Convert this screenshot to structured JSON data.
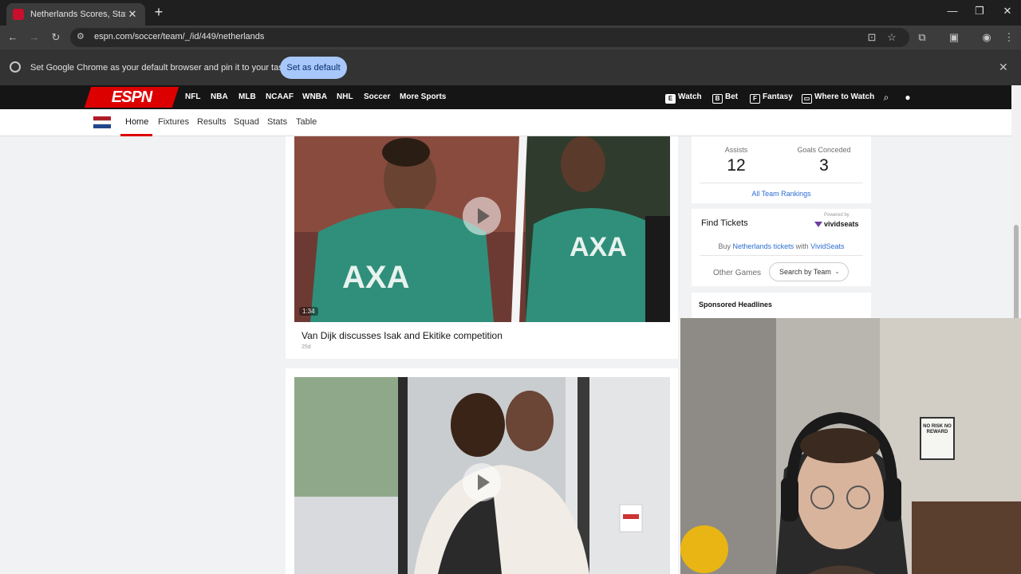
{
  "browser": {
    "tab_title": "Netherlands Scores, Stats and Highlights - ESPN",
    "tab_close": "✕",
    "new_tab": "+",
    "url": "espn.com/soccer/team/_/id/449/netherlands",
    "infobar_text": "Set Google Chrome as your default browser and pin it to your taskbar",
    "set_default_label": "Set as default",
    "infobar_close": "✕",
    "window_controls": {
      "minimize": "—",
      "restore": "❐",
      "close": "✕"
    },
    "toolbar_icons": {
      "back": "←",
      "forward": "→",
      "reload": "↻",
      "site_info": "⚙",
      "install": "⊡",
      "bookmark": "☆",
      "extensions": "⧉",
      "side_panel": "▣",
      "profile": "◉",
      "menu": "⋮"
    }
  },
  "espn_nav": {
    "logo": "ESPN",
    "links": [
      "NFL",
      "NBA",
      "MLB",
      "NCAAF",
      "WNBA",
      "NHL",
      "Soccer",
      "More Sports"
    ],
    "active": "Soccer",
    "right_links": {
      "watch": "Watch",
      "bet": "Bet",
      "fantasy": "Fantasy",
      "where_to_watch": "Where to Watch"
    },
    "icons": {
      "watch": "E",
      "bet": "B",
      "fantasy": "F",
      "where_to_watch": "▭",
      "search": "⌕",
      "account": "●"
    }
  },
  "team_nav": {
    "flag_colors": [
      "#ae1c28",
      "#ffffff",
      "#21468b"
    ],
    "items": [
      "Home",
      "Fixtures",
      "Results",
      "Squad",
      "Stats",
      "Table"
    ],
    "active": "Home"
  },
  "videos": [
    {
      "title": "Van Dijk discusses Isak and Ekitike competition",
      "age": "25d",
      "duration": "1:34"
    },
    {
      "title": "",
      "age": "",
      "duration": ""
    }
  ],
  "team_stats": {
    "assists_label": "Assists",
    "assists_value": "12",
    "goals_conceded_label": "Goals Conceded",
    "goals_conceded_value": "3",
    "rankings_link": "All Team Rankings"
  },
  "tickets": {
    "title": "Find Tickets",
    "powered_by": "Powered by",
    "vendor": "vividseats",
    "buy_prefix": "Buy ",
    "buy_link": "Netherlands tickets",
    "buy_mid": " with ",
    "vendor_link": "VividSeats",
    "other_games_label": "Other Games",
    "search_by_team": "Search by Team"
  },
  "sponsored": {
    "title": "Sponsored Headlines"
  },
  "webcam": {
    "poster_text": "NO RISK NO REWARD"
  }
}
